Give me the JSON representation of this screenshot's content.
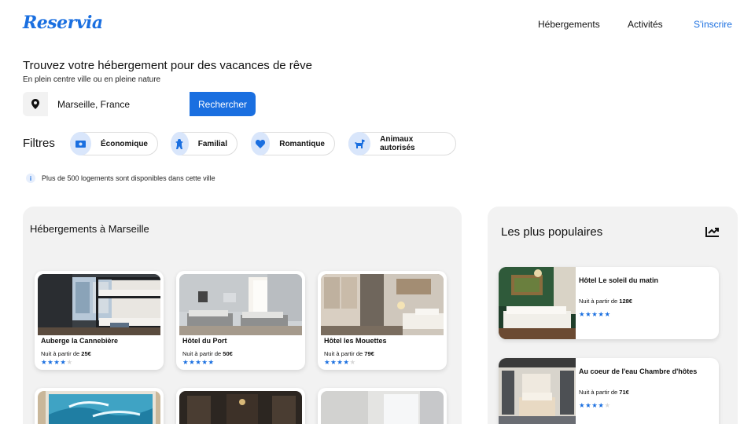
{
  "brand": {
    "logo": "Reservia",
    "accent": "#1a6fe0"
  },
  "nav": {
    "items": [
      "Hébergements",
      "Activités",
      "S'inscrire"
    ]
  },
  "hero": {
    "title": "Trouvez votre hébergement pour des vacances de rêve",
    "subtitle": "En plein centre ville ou en pleine nature"
  },
  "search": {
    "value": "Marseille, France",
    "button": "Rechercher",
    "icon": "map-pin-icon"
  },
  "filters": {
    "label": "Filtres",
    "items": [
      {
        "label": "Économique",
        "icon": "money-icon"
      },
      {
        "label": "Familial",
        "icon": "child-icon"
      },
      {
        "label": "Romantique",
        "icon": "heart-icon"
      },
      {
        "label": "Animaux autorisés",
        "icon": "dog-icon"
      }
    ]
  },
  "info": {
    "text": "Plus de 500 logements sont disponibles dans cette ville",
    "icon": "info-icon"
  },
  "listings": {
    "title": "Hébergements à Marseille",
    "price_prefix": "Nuit à partir de",
    "cards": [
      {
        "name": "Auberge la Cannebière",
        "price": "25€",
        "rating": 4,
        "rating_max": 5
      },
      {
        "name": "Hôtel du Port",
        "price": "50€",
        "rating": 5,
        "rating_max": 5
      },
      {
        "name": "Hôtel les Mouettes",
        "price": "79€",
        "rating": 4,
        "rating_max": 5
      }
    ]
  },
  "popular": {
    "title": "Les plus populaires",
    "icon": "trending-up-icon",
    "price_prefix": "Nuit à partir de",
    "cards": [
      {
        "name": "Hôtel Le soleil du matin",
        "price": "128€",
        "rating": 5,
        "rating_max": 5
      },
      {
        "name": "Au coeur de l'eau Chambre d'hôtes",
        "price": "71€",
        "rating": 4,
        "rating_max": 5
      }
    ]
  }
}
